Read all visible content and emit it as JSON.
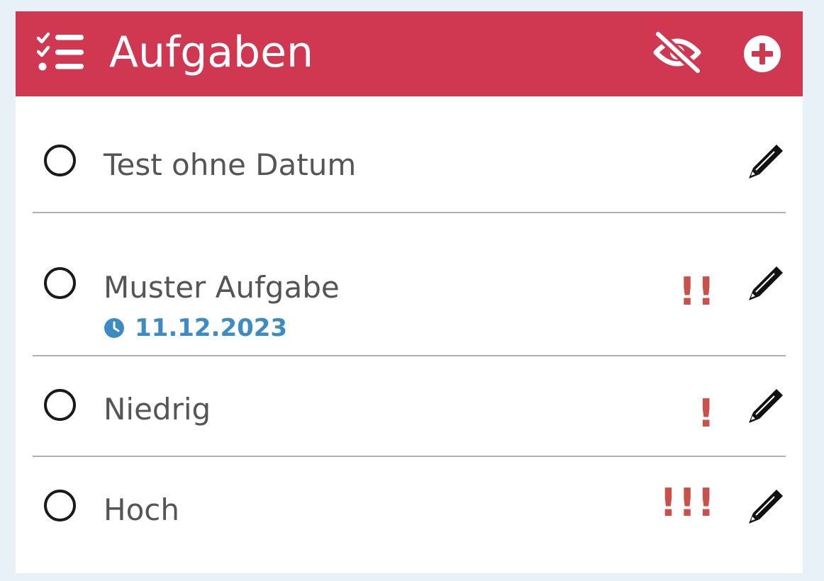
{
  "header": {
    "title": "Aufgaben",
    "icons": {
      "list": "tasks-list-icon",
      "toggle_visibility": "eye-slash-icon",
      "add": "plus-circle-icon"
    }
  },
  "colors": {
    "header_background": "#d03750",
    "priority": "#c9514a",
    "date": "#3d8bc4",
    "page_background": "#e8f0f8"
  },
  "tasks": [
    {
      "title": "Test ohne Datum",
      "due_date": "",
      "priority": "",
      "priority_level": 0
    },
    {
      "title": "Muster Aufgabe",
      "due_date": "11.12.2023",
      "priority": "!!",
      "priority_level": 2
    },
    {
      "title": "Niedrig",
      "due_date": "",
      "priority": "!",
      "priority_level": 1
    },
    {
      "title": "Hoch",
      "due_date": "",
      "priority": "!!!",
      "priority_level": 3
    }
  ]
}
